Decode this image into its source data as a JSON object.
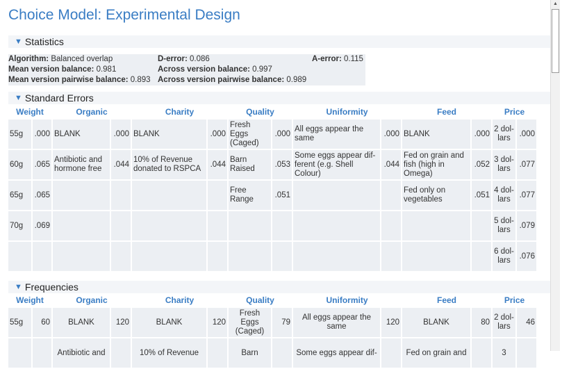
{
  "title": "Choice Model: Experimental Design",
  "sections": {
    "statistics": "Statistics",
    "standard_errors": "Standard Errors",
    "frequencies": "Frequencies"
  },
  "stats": {
    "algorithm_label": "Algorithm:",
    "algorithm": "Balanced overlap",
    "derror_label": "D-error:",
    "derror": "0.086",
    "aerror_label": "A-error:",
    "aerror": "0.115",
    "mvb_label": "Mean version balance:",
    "mvb": "0.981",
    "avb_label": "Across version balance:",
    "avb": "0.997",
    "mvpb_label": "Mean version pairwise balance:",
    "mvpb": "0.893",
    "avpb_label": "Across version pairwise balance:",
    "avpb": "0.989"
  },
  "columns": [
    "Weight",
    "Organic",
    "Charity",
    "Quality",
    "Uniformity",
    "Feed",
    "Price"
  ],
  "se_rows": [
    [
      "55g",
      ".000",
      "BLANK",
      ".000",
      "BLANK",
      ".000",
      "Fresh Eggs (Caged)",
      ".000",
      "All eggs appear the same",
      ".000",
      "BLANK",
      ".000",
      "2 dol- lars",
      ".000"
    ],
    [
      "60g",
      ".065",
      "Antibiotic and hormone free",
      ".044",
      "10% of Revenue donated to RSPCA",
      ".044",
      "Barn Raised",
      ".053",
      "Some eggs appear dif- ferent (e.g. Shell Colour)",
      ".044",
      "Fed on grain and fish (high in Omega)",
      ".052",
      "3 dol- lars",
      ".077"
    ],
    [
      "65g",
      ".065",
      "",
      "",
      "",
      "",
      "Free Range",
      ".051",
      "",
      "",
      "Fed only on vegetables",
      ".051",
      "4 dol- lars",
      ".077"
    ],
    [
      "70g",
      ".069",
      "",
      "",
      "",
      "",
      "",
      "",
      "",
      "",
      "",
      "",
      "5 dol- lars",
      ".079"
    ],
    [
      "",
      "",
      "",
      "",
      "",
      "",
      "",
      "",
      "",
      "",
      "",
      "",
      "6 dol- lars",
      ".076"
    ]
  ],
  "freq_rows": [
    [
      "55g",
      "60",
      "BLANK",
      "120",
      "BLANK",
      "120",
      "Fresh Eggs (Caged)",
      "79",
      "All eggs appear the same",
      "120",
      "BLANK",
      "80",
      "2 dol- lars",
      "46"
    ],
    [
      "",
      "",
      "Antibiotic and",
      "",
      "10% of Revenue",
      "",
      "Barn",
      "",
      "Some eggs appear dif-",
      "",
      "Fed on grain and",
      "",
      "3",
      ""
    ]
  ]
}
